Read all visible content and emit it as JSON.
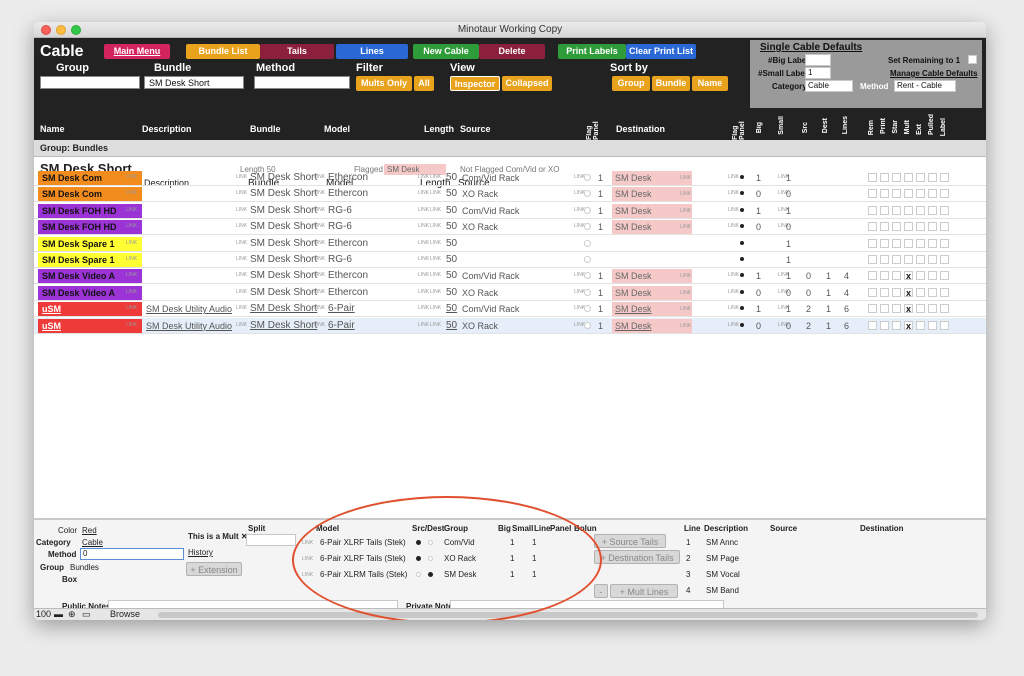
{
  "window": {
    "title": "Minotaur Working Copy"
  },
  "header": {
    "title": "Cable",
    "main_menu": "Main Menu",
    "bundle_list": "Bundle List",
    "tails": "Tails",
    "lines": "Lines",
    "new_cable": "New Cable",
    "delete": "Delete",
    "print_labels": "Print Labels",
    "clear_print_list": "Clear Print List",
    "group_label": "Group",
    "bundle_label": "Bundle",
    "bundle_value": "SM Desk Short",
    "method_label": "Method",
    "filter_label": "Filter",
    "mults_only": "Mults Only",
    "all": "All",
    "view_label": "View",
    "inspector": "Inspector",
    "collapsed": "Collapsed",
    "sort_by_label": "Sort by",
    "sort_group": "Group",
    "sort_bundle": "Bundle",
    "sort_name": "Name"
  },
  "defaults": {
    "title": "Single Cable Defaults",
    "big_labels": "#Big Labels",
    "small_labels": "#Small Labels",
    "small_value": "1",
    "category_label": "Category",
    "category_value": "Cable",
    "set_remaining": "Set Remaining to 1",
    "manage": "Manage Cable Defaults",
    "method_label": "Method",
    "method_value": "Rent - Cable"
  },
  "columns": {
    "name": "Name",
    "description": "Description",
    "bundle": "Bundle",
    "model": "Model",
    "length": "Length",
    "source": "Source",
    "flag_panel": "Flag Panel",
    "destination": "Destination",
    "big": "Big",
    "small": "Small",
    "src": "Src",
    "dest": "Dest",
    "lines": "Lines",
    "rem": "Rem",
    "print": "Print",
    "star": "Star",
    "mult": "Mult",
    "ext": "Ext",
    "pulled": "Pulled",
    "label": "Label"
  },
  "group": {
    "label": "Group: Bundles"
  },
  "bundle_head": {
    "name": "SM Desk Short",
    "length_text": "Length 50",
    "flagged_text": "Flagged",
    "flagged_value": "SM Desk",
    "not_flagged_text": "Not Flagged  Com/Vid or XO",
    "link": "LINK"
  },
  "rows": [
    {
      "name": "SM Desk Com",
      "color": "#f28c1e",
      "bundle": "SM Desk Short",
      "model": "Ethercon",
      "length": "50",
      "source": "Com/Vid Rack",
      "flag": "1",
      "dest": "SM Desk",
      "big": "1",
      "small": "1",
      "src": "",
      "dst": "",
      "lines": "",
      "mult": ""
    },
    {
      "name": "SM Desk Com",
      "color": "#f28c1e",
      "bundle": "SM Desk Short",
      "model": "Ethercon",
      "length": "50",
      "source": "XO Rack",
      "flag": "1",
      "dest": "SM Desk",
      "big": "0",
      "small": "0",
      "src": "",
      "dst": "",
      "lines": "",
      "mult": ""
    },
    {
      "name": "SM Desk FOH HD",
      "color": "#9b33d6",
      "bundle": "SM Desk Short",
      "model": "RG-6",
      "length": "50",
      "source": "Com/Vid Rack",
      "flag": "1",
      "dest": "SM Desk",
      "big": "1",
      "small": "1",
      "src": "",
      "dst": "",
      "lines": "",
      "mult": ""
    },
    {
      "name": "SM Desk FOH HD",
      "color": "#9b33d6",
      "bundle": "SM Desk Short",
      "model": "RG-6",
      "length": "50",
      "source": "XO Rack",
      "flag": "1",
      "dest": "SM Desk",
      "big": "0",
      "small": "0",
      "src": "",
      "dst": "",
      "lines": "",
      "mult": ""
    },
    {
      "name": "SM Desk Spare 1",
      "color": "#ffff33",
      "bundle": "SM Desk Short",
      "model": "Ethercon",
      "length": "50",
      "source": "",
      "flag": "",
      "dest": "",
      "big": "",
      "small": "1",
      "src": "",
      "dst": "",
      "lines": "",
      "mult": ""
    },
    {
      "name": "SM Desk Spare 1",
      "color": "#ffff33",
      "bundle": "SM Desk Short",
      "model": "RG-6",
      "length": "50",
      "source": "",
      "flag": "",
      "dest": "",
      "big": "",
      "small": "1",
      "src": "",
      "dst": "",
      "lines": "",
      "mult": ""
    },
    {
      "name": "SM Desk Video A",
      "color": "#9b33d6",
      "bundle": "SM Desk Short",
      "model": "Ethercon",
      "length": "50",
      "source": "Com/Vid Rack",
      "flag": "1",
      "dest": "SM Desk",
      "big": "1",
      "small": "1",
      "src": "0",
      "dst": "1",
      "lines": "4",
      "mult": "x"
    },
    {
      "name": "SM Desk Video A",
      "color": "#9b33d6",
      "bundle": "SM Desk Short",
      "model": "Ethercon",
      "length": "50",
      "source": "XO Rack",
      "flag": "1",
      "dest": "SM Desk",
      "big": "0",
      "small": "0",
      "src": "0",
      "dst": "1",
      "lines": "4",
      "mult": "x"
    },
    {
      "name": "uSM",
      "color": "#ef3a3a",
      "desc": "SM Desk Utility Audio",
      "bundle": "SM Desk Short",
      "model": "6-Pair",
      "length": "50",
      "source": "Com/Vid Rack",
      "flag": "1",
      "dest": "SM Desk",
      "big": "1",
      "small": "1",
      "src": "2",
      "dst": "1",
      "lines": "6",
      "mult": "x"
    },
    {
      "name": "uSM",
      "color": "#ef3a3a",
      "desc": "SM Desk Utility Audio",
      "bundle": "SM Desk Short",
      "model": "6-Pair",
      "length": "50",
      "source": "XO Rack",
      "flag": "1",
      "dest": "SM Desk",
      "big": "0",
      "small": "0",
      "src": "2",
      "dst": "1",
      "lines": "6",
      "mult": "x"
    }
  ],
  "bottom": {
    "color_label": "Color",
    "color_value": "Red",
    "category_label": "Category",
    "category_value": "Cable",
    "method_label": "Method",
    "method_value": "0",
    "group_label": "Group",
    "group_value": "Bundles",
    "box_label": "Box",
    "is_mult": "This is a Mult ✕",
    "split_label": "Split",
    "history": "History",
    "extension": "+ Extension",
    "public_notes": "Public Notes",
    "private_notes": "Private Notes",
    "tails_headers": [
      "Model",
      "Src/Dest",
      "Group",
      "Big",
      "Small",
      "Line",
      "Panel",
      "Bolun"
    ],
    "tails": [
      {
        "model": "6-Pair XLRF Tails (Stek)",
        "group": "Com/Vid",
        "big": "1",
        "small": "1",
        "src": true
      },
      {
        "model": "6-Pair XLRF Tails (Stek)",
        "group": "XO Rack",
        "big": "1",
        "small": "1",
        "src": true
      },
      {
        "model": "6-Pair XLRM Tails (Stek)",
        "group": "SM Desk",
        "big": "1",
        "small": "1",
        "src": false
      }
    ],
    "source_tails": "+ Source Tails",
    "dest_tails": "+ Destination Tails",
    "minus": "-",
    "mult_lines": "+ Mult Lines",
    "lines_headers": [
      "Line",
      "Description",
      "Source",
      "Destination"
    ],
    "lines": [
      {
        "line": "1",
        "desc": "SM Annc"
      },
      {
        "line": "2",
        "desc": "SM Page"
      },
      {
        "line": "3",
        "desc": "SM Vocal"
      },
      {
        "line": "4",
        "desc": "SM Band"
      }
    ]
  },
  "status": {
    "zoom": "100",
    "mode": "Browse"
  }
}
